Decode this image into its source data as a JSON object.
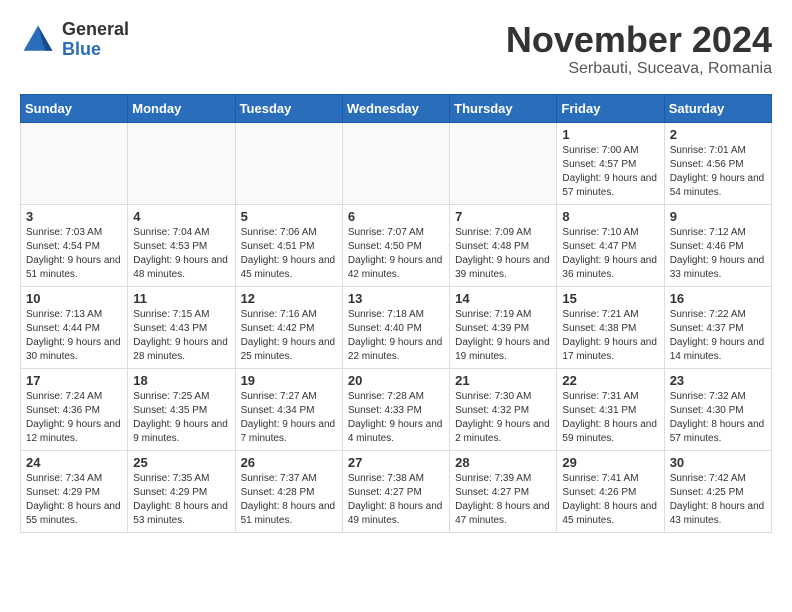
{
  "logo": {
    "general": "General",
    "blue": "Blue"
  },
  "title": {
    "month": "November 2024",
    "location": "Serbauti, Suceava, Romania"
  },
  "weekdays": [
    "Sunday",
    "Monday",
    "Tuesday",
    "Wednesday",
    "Thursday",
    "Friday",
    "Saturday"
  ],
  "weeks": [
    [
      {
        "day": "",
        "sunrise": "",
        "sunset": "",
        "daylight": ""
      },
      {
        "day": "",
        "sunrise": "",
        "sunset": "",
        "daylight": ""
      },
      {
        "day": "",
        "sunrise": "",
        "sunset": "",
        "daylight": ""
      },
      {
        "day": "",
        "sunrise": "",
        "sunset": "",
        "daylight": ""
      },
      {
        "day": "",
        "sunrise": "",
        "sunset": "",
        "daylight": ""
      },
      {
        "day": "1",
        "sunrise": "Sunrise: 7:00 AM",
        "sunset": "Sunset: 4:57 PM",
        "daylight": "Daylight: 9 hours and 57 minutes."
      },
      {
        "day": "2",
        "sunrise": "Sunrise: 7:01 AM",
        "sunset": "Sunset: 4:56 PM",
        "daylight": "Daylight: 9 hours and 54 minutes."
      }
    ],
    [
      {
        "day": "3",
        "sunrise": "Sunrise: 7:03 AM",
        "sunset": "Sunset: 4:54 PM",
        "daylight": "Daylight: 9 hours and 51 minutes."
      },
      {
        "day": "4",
        "sunrise": "Sunrise: 7:04 AM",
        "sunset": "Sunset: 4:53 PM",
        "daylight": "Daylight: 9 hours and 48 minutes."
      },
      {
        "day": "5",
        "sunrise": "Sunrise: 7:06 AM",
        "sunset": "Sunset: 4:51 PM",
        "daylight": "Daylight: 9 hours and 45 minutes."
      },
      {
        "day": "6",
        "sunrise": "Sunrise: 7:07 AM",
        "sunset": "Sunset: 4:50 PM",
        "daylight": "Daylight: 9 hours and 42 minutes."
      },
      {
        "day": "7",
        "sunrise": "Sunrise: 7:09 AM",
        "sunset": "Sunset: 4:48 PM",
        "daylight": "Daylight: 9 hours and 39 minutes."
      },
      {
        "day": "8",
        "sunrise": "Sunrise: 7:10 AM",
        "sunset": "Sunset: 4:47 PM",
        "daylight": "Daylight: 9 hours and 36 minutes."
      },
      {
        "day": "9",
        "sunrise": "Sunrise: 7:12 AM",
        "sunset": "Sunset: 4:46 PM",
        "daylight": "Daylight: 9 hours and 33 minutes."
      }
    ],
    [
      {
        "day": "10",
        "sunrise": "Sunrise: 7:13 AM",
        "sunset": "Sunset: 4:44 PM",
        "daylight": "Daylight: 9 hours and 30 minutes."
      },
      {
        "day": "11",
        "sunrise": "Sunrise: 7:15 AM",
        "sunset": "Sunset: 4:43 PM",
        "daylight": "Daylight: 9 hours and 28 minutes."
      },
      {
        "day": "12",
        "sunrise": "Sunrise: 7:16 AM",
        "sunset": "Sunset: 4:42 PM",
        "daylight": "Daylight: 9 hours and 25 minutes."
      },
      {
        "day": "13",
        "sunrise": "Sunrise: 7:18 AM",
        "sunset": "Sunset: 4:40 PM",
        "daylight": "Daylight: 9 hours and 22 minutes."
      },
      {
        "day": "14",
        "sunrise": "Sunrise: 7:19 AM",
        "sunset": "Sunset: 4:39 PM",
        "daylight": "Daylight: 9 hours and 19 minutes."
      },
      {
        "day": "15",
        "sunrise": "Sunrise: 7:21 AM",
        "sunset": "Sunset: 4:38 PM",
        "daylight": "Daylight: 9 hours and 17 minutes."
      },
      {
        "day": "16",
        "sunrise": "Sunrise: 7:22 AM",
        "sunset": "Sunset: 4:37 PM",
        "daylight": "Daylight: 9 hours and 14 minutes."
      }
    ],
    [
      {
        "day": "17",
        "sunrise": "Sunrise: 7:24 AM",
        "sunset": "Sunset: 4:36 PM",
        "daylight": "Daylight: 9 hours and 12 minutes."
      },
      {
        "day": "18",
        "sunrise": "Sunrise: 7:25 AM",
        "sunset": "Sunset: 4:35 PM",
        "daylight": "Daylight: 9 hours and 9 minutes."
      },
      {
        "day": "19",
        "sunrise": "Sunrise: 7:27 AM",
        "sunset": "Sunset: 4:34 PM",
        "daylight": "Daylight: 9 hours and 7 minutes."
      },
      {
        "day": "20",
        "sunrise": "Sunrise: 7:28 AM",
        "sunset": "Sunset: 4:33 PM",
        "daylight": "Daylight: 9 hours and 4 minutes."
      },
      {
        "day": "21",
        "sunrise": "Sunrise: 7:30 AM",
        "sunset": "Sunset: 4:32 PM",
        "daylight": "Daylight: 9 hours and 2 minutes."
      },
      {
        "day": "22",
        "sunrise": "Sunrise: 7:31 AM",
        "sunset": "Sunset: 4:31 PM",
        "daylight": "Daylight: 8 hours and 59 minutes."
      },
      {
        "day": "23",
        "sunrise": "Sunrise: 7:32 AM",
        "sunset": "Sunset: 4:30 PM",
        "daylight": "Daylight: 8 hours and 57 minutes."
      }
    ],
    [
      {
        "day": "24",
        "sunrise": "Sunrise: 7:34 AM",
        "sunset": "Sunset: 4:29 PM",
        "daylight": "Daylight: 8 hours and 55 minutes."
      },
      {
        "day": "25",
        "sunrise": "Sunrise: 7:35 AM",
        "sunset": "Sunset: 4:29 PM",
        "daylight": "Daylight: 8 hours and 53 minutes."
      },
      {
        "day": "26",
        "sunrise": "Sunrise: 7:37 AM",
        "sunset": "Sunset: 4:28 PM",
        "daylight": "Daylight: 8 hours and 51 minutes."
      },
      {
        "day": "27",
        "sunrise": "Sunrise: 7:38 AM",
        "sunset": "Sunset: 4:27 PM",
        "daylight": "Daylight: 8 hours and 49 minutes."
      },
      {
        "day": "28",
        "sunrise": "Sunrise: 7:39 AM",
        "sunset": "Sunset: 4:27 PM",
        "daylight": "Daylight: 8 hours and 47 minutes."
      },
      {
        "day": "29",
        "sunrise": "Sunrise: 7:41 AM",
        "sunset": "Sunset: 4:26 PM",
        "daylight": "Daylight: 8 hours and 45 minutes."
      },
      {
        "day": "30",
        "sunrise": "Sunrise: 7:42 AM",
        "sunset": "Sunset: 4:25 PM",
        "daylight": "Daylight: 8 hours and 43 minutes."
      }
    ]
  ]
}
